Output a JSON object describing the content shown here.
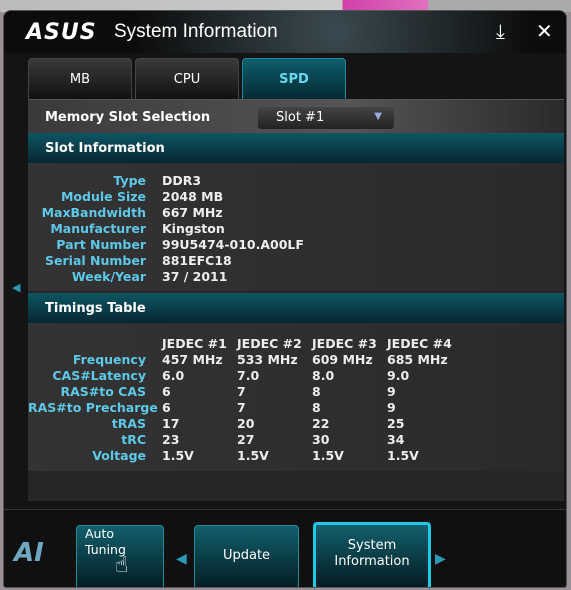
{
  "window": {
    "logo": "ASUS",
    "title": "System Information",
    "download_icon": "download-icon",
    "close_icon": "close-icon"
  },
  "tabs": [
    {
      "label": "MB"
    },
    {
      "label": "CPU"
    },
    {
      "label": "SPD",
      "active": true
    }
  ],
  "slot_selection": {
    "label": "Memory Slot Selection",
    "value": "Slot #1"
  },
  "slot_info": {
    "title": "Slot Information",
    "rows": [
      {
        "k": "Type",
        "v": "DDR3"
      },
      {
        "k": "Module Size",
        "v": "2048 MB"
      },
      {
        "k": "MaxBandwidth",
        "v": "667 MHz"
      },
      {
        "k": "Manufacturer",
        "v": "Kingston"
      },
      {
        "k": "Part Number",
        "v": "99U5474-010.A00LF"
      },
      {
        "k": "Serial Number",
        "v": "881EFC18"
      },
      {
        "k": "Week/Year",
        "v": "37 / 2011"
      }
    ]
  },
  "timings": {
    "title": "Timings Table",
    "columns": [
      "JEDEC #1",
      "JEDEC #2",
      "JEDEC #3",
      "JEDEC #4"
    ],
    "rows": [
      {
        "k": "Frequency",
        "v": [
          "457 MHz",
          "533 MHz",
          "609 MHz",
          "685 MHz"
        ]
      },
      {
        "k": "CAS#Latency",
        "v": [
          "6.0",
          "7.0",
          "8.0",
          "9.0"
        ]
      },
      {
        "k": "RAS#to CAS",
        "v": [
          "6",
          "7",
          "8",
          "9"
        ]
      },
      {
        "k": "RAS#to Precharge",
        "v": [
          "6",
          "7",
          "8",
          "9"
        ]
      },
      {
        "k": "tRAS",
        "v": [
          "17",
          "20",
          "22",
          "25"
        ]
      },
      {
        "k": "tRC",
        "v": [
          "23",
          "27",
          "30",
          "34"
        ]
      },
      {
        "k": "Voltage",
        "v": [
          "1.5V",
          "1.5V",
          "1.5V",
          "1.5V"
        ]
      }
    ]
  },
  "bottom": {
    "logo": "AI",
    "auto_tuning": [
      "Auto",
      "Tuning"
    ],
    "update": "Update",
    "system_information": [
      "System",
      "Information"
    ]
  },
  "colors": {
    "accent": "#20c8e8",
    "label": "#5ec8e8",
    "header": "#0e5563"
  }
}
